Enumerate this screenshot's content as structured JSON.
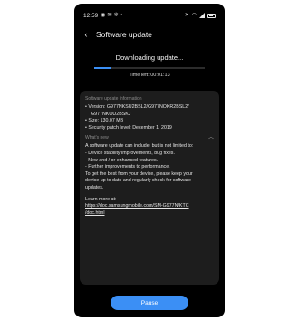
{
  "status_bar": {
    "time": "12:59",
    "left_icons": [
      "notification-icon",
      "message-icon",
      "settings-icon",
      "dot-icon"
    ],
    "right_icons": [
      "mute-icon",
      "wifi-icon",
      "signal-icon",
      "battery-icon"
    ]
  },
  "header": {
    "back_icon": "‹",
    "title": "Software update"
  },
  "download": {
    "title": "Downloading update...",
    "progress_fraction": 0.15,
    "time_left": "Time left: 00:01:13"
  },
  "info": {
    "heading": "Software update information",
    "version_line1": "• Version: G977NKSU2BSL2/G977NOKR2BSL2/",
    "version_line2": "G977NKOU2BSKJ",
    "size": "• Size: 130.07 MB",
    "patch": "• Security patch level: December 1, 2019"
  },
  "whats_new": {
    "heading": "What's new",
    "lines": [
      "A software update can include, but is not limited to:",
      "- Device stability improvements, bug fixes.",
      "- New and / or enhanced features.",
      "- Further improvements to performance.",
      "To get the best from your device, please keep your",
      "device up to date and regularly check for software",
      "updates."
    ],
    "learn_more": "Learn more at:",
    "link_line1": "https://doc.samsungmobile.com/SM-G977N/KTC",
    "link_line2": "/doc.html"
  },
  "pause_button": {
    "label": "Pause"
  },
  "colors": {
    "accent": "#3b8ff5",
    "background": "#000000",
    "card": "#1d1d1d"
  }
}
